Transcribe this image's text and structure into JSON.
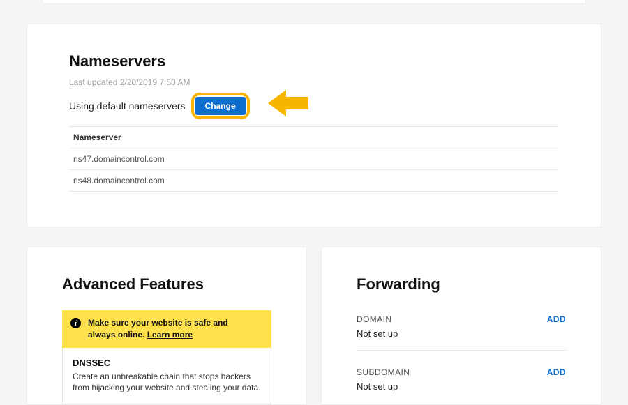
{
  "nameservers": {
    "title": "Nameservers",
    "last_updated": "Last updated 2/20/2019 7:50 AM",
    "using_text": "Using default nameservers",
    "change_label": "Change",
    "header": "Nameserver",
    "rows": [
      "ns47.domaincontrol.com",
      "ns48.domaincontrol.com"
    ]
  },
  "advanced": {
    "title": "Advanced Features",
    "alert_line1": "Make sure your website is safe and",
    "alert_line2_pre": "always online. ",
    "alert_learn": "Learn more",
    "dnssec_title": "DNSSEC",
    "dnssec_desc": "Create an unbreakable chain that stops hackers from hijacking your website and stealing your data."
  },
  "forwarding": {
    "title": "Forwarding",
    "domain_label": "DOMAIN",
    "domain_value": "Not set up",
    "subdomain_label": "SUBDOMAIN",
    "subdomain_value": "Not set up",
    "add_label": "ADD"
  },
  "colors": {
    "accent": "#0d6dcf",
    "highlight": "#f7b500",
    "alert_bg": "#ffe14d"
  }
}
